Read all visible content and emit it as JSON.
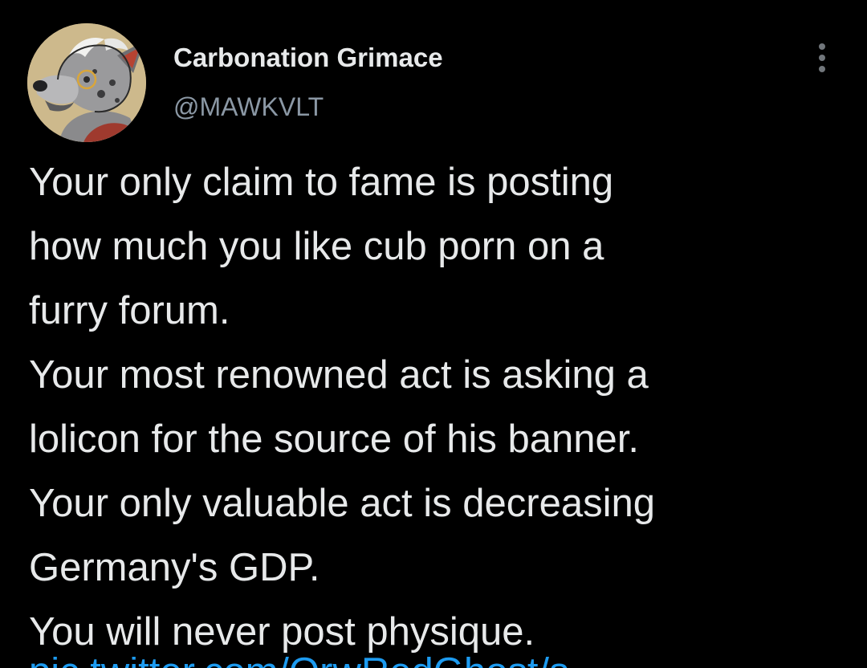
{
  "tweet": {
    "author": {
      "display_name": "Carbonation Grimace",
      "handle": "@MAWKVLT"
    },
    "lines": [
      "Your only claim to fame is posting",
      "how much you like cub porn on a",
      "furry forum.",
      "Your most renowned act is asking a",
      "lolicon for the source of his banner.",
      "Your only valuable act is decreasing",
      "Germany's GDP.",
      "You will never post physique."
    ]
  },
  "icons": {
    "more": "more-options-icon"
  },
  "colors": {
    "background": "#000000",
    "primary_text": "#e7e9ea",
    "secondary_text": "#8b98a5",
    "link": "#1d9bf0",
    "avatar_background": "#cdb98c"
  }
}
